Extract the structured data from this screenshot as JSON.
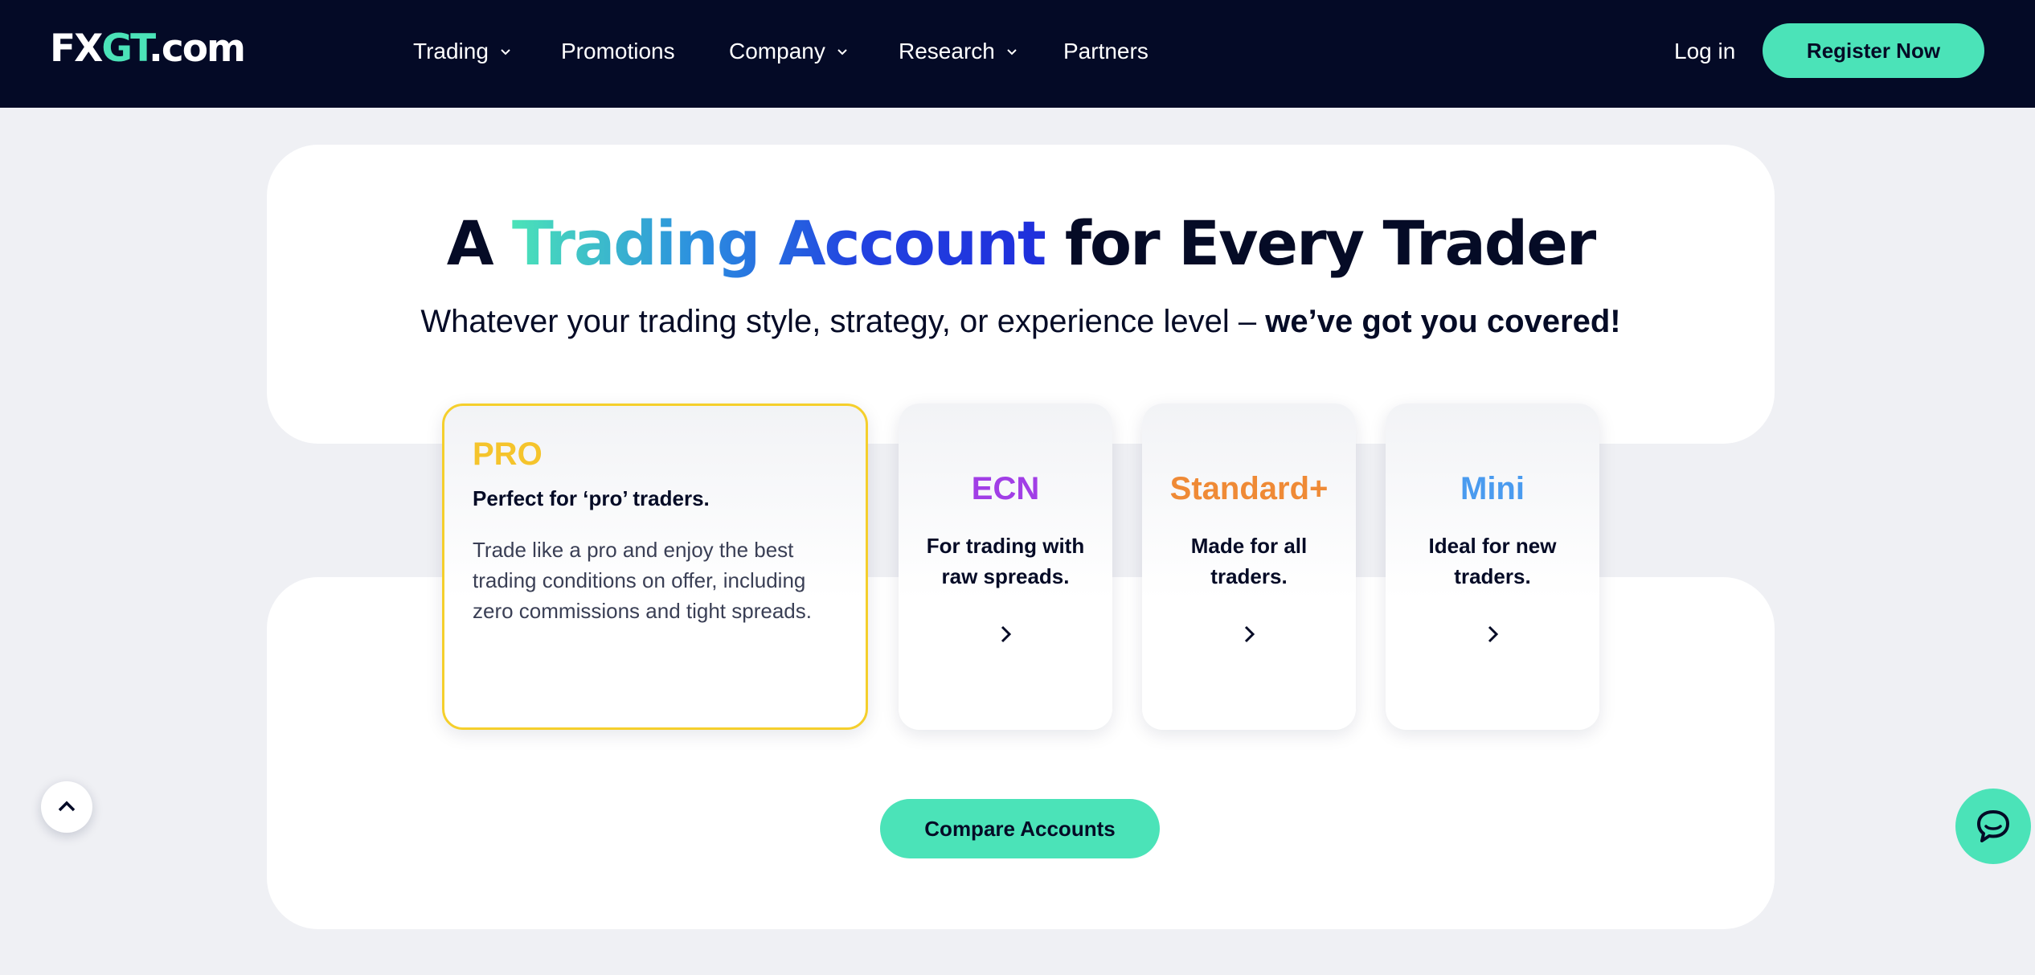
{
  "header": {
    "logo": {
      "part1": "FX",
      "part2": "GT",
      "part3": ".com"
    },
    "nav": [
      {
        "label": "Trading",
        "has_dropdown": true
      },
      {
        "label": "Promotions",
        "has_dropdown": false
      },
      {
        "label": "Company",
        "has_dropdown": true
      },
      {
        "label": "Research",
        "has_dropdown": true
      },
      {
        "label": "Partners",
        "has_dropdown": false
      }
    ],
    "login_label": "Log in",
    "register_label": "Register Now"
  },
  "hero": {
    "title_part1": "A ",
    "title_highlight": "Trading Account",
    "title_part2": " for Every Trader",
    "subtitle_regular": "Whatever your trading style, strategy, or experience level – ",
    "subtitle_bold": "we’ve got you covered!"
  },
  "accounts": [
    {
      "name": "PRO",
      "tagline": "Perfect for ‘pro’ traders.",
      "description": "Trade like a pro and enjoy the best trading conditions on offer, including zero commissions and tight spreads.",
      "color": "#f5c42c",
      "selected": true
    },
    {
      "name": "ECN",
      "tagline": "For trading with raw spreads.",
      "color": "#a13ee6",
      "icon": "chevron-right-icon"
    },
    {
      "name": "Standard+",
      "tagline": "Made for all traders.",
      "color": "#ef8a36",
      "icon": "chevron-right-icon"
    },
    {
      "name": "Mini",
      "tagline": "Ideal for new traders.",
      "color": "#4a9bef",
      "icon": "chevron-right-icon"
    }
  ],
  "compare_label": "Compare Accounts",
  "floating": {
    "scroll_top_icon": "chevron-up-icon",
    "chat_icon": "chat-bubble-icon"
  },
  "colors": {
    "header_bg": "#040a26",
    "accent": "#4be3b8",
    "page_bg": "#eff0f4"
  }
}
